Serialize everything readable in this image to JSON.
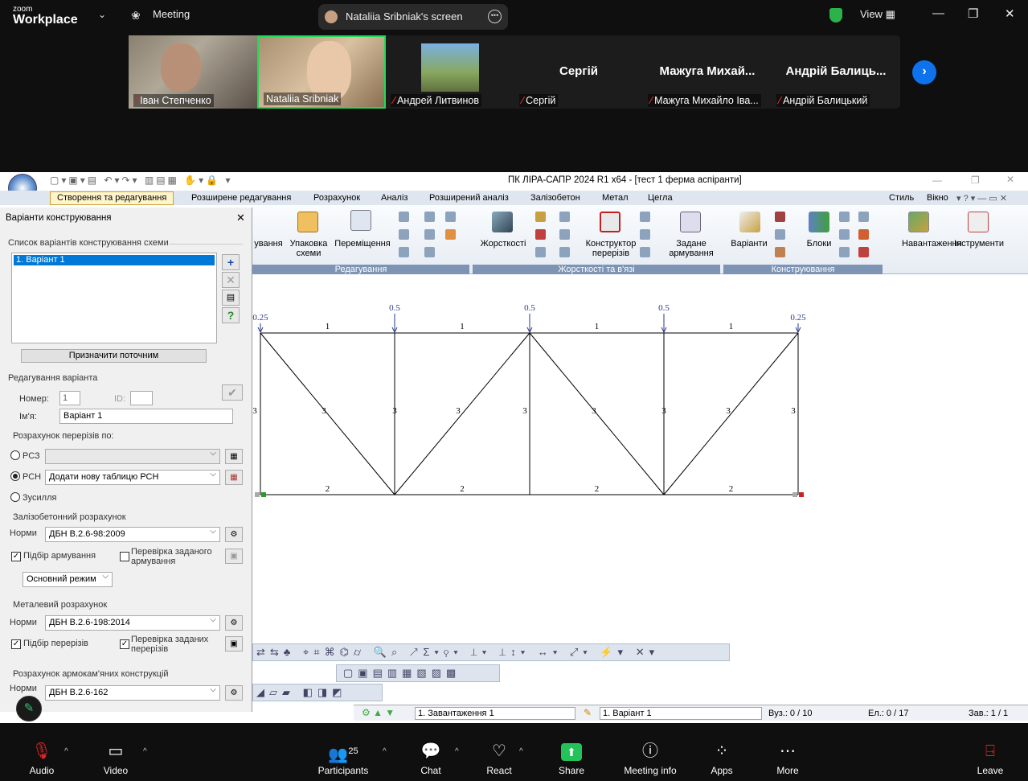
{
  "zoom": {
    "logo_top": "zoom",
    "logo_bottom": "Workplace",
    "meeting": "Meeting",
    "screen_share": "Nataliia Sribniak's screen",
    "view": "View",
    "participants": [
      {
        "name": "Іван Степченко",
        "muted": true,
        "video": true
      },
      {
        "name": "Nataliia Sribniak",
        "muted": false,
        "video": true
      },
      {
        "name": "Андрей Литвинов",
        "muted": true,
        "video": true
      },
      {
        "name": "Сергій",
        "muted": true,
        "big": "Сергій"
      },
      {
        "name": "Мажуга Михайло Іва...",
        "muted": true,
        "big": "Мажуга  Михай..."
      },
      {
        "name": "Андрій Балицький",
        "muted": true,
        "big": "Андрій  Балиць..."
      }
    ],
    "toolbar": {
      "audio": "Audio",
      "video": "Video",
      "participants": "Participants",
      "participants_count": "25",
      "chat": "Chat",
      "react": "React",
      "share": "Share",
      "meeting_info": "Meeting info",
      "apps": "Apps",
      "more": "More",
      "leave": "Leave"
    }
  },
  "lira": {
    "title": "ПК ЛІРА-САПР  2024 R1 x64 - [тест 1 ферма аспіранти]",
    "tabs": [
      "Створення та редагування",
      "Розширене редагування",
      "Розрахунок",
      "Аналіз",
      "Розширений аналіз",
      "Залізобетон",
      "Метал",
      "Цегла"
    ],
    "right_menu": [
      "Стиль",
      "Вікно"
    ],
    "ribbon": {
      "buttons": [
        "ування",
        "Упаковка схеми",
        "Переміщення",
        "Жорсткості",
        "Конструктор перерізів",
        "Задане армування",
        "Варіанти",
        "Блоки",
        "Навантаження",
        "Інструменти"
      ],
      "groups": [
        "Редагування",
        "Жорсткості та в'язі",
        "Конструювання"
      ]
    },
    "dialog": {
      "title": "Варіанти конструювання",
      "list_label": "Список варіантів конструювання схеми",
      "list_items": [
        "1. Варіант 1"
      ],
      "assign_btn": "Призначити поточним",
      "edit_label": "Редагування варіанта",
      "number_label": "Номер:",
      "number_value": "1",
      "id_label": "ID:",
      "name_label": "Ім'я:",
      "name_value": "Варіант 1",
      "calc_label": "Розрахунок перерізів по:",
      "opt_rsz": "РСЗ",
      "opt_rsn": "РСН",
      "opt_forces": "Зусилля",
      "rsn_combo": "Додати нову таблицю РСН",
      "rc_label": "Залізобетонний розрахунок",
      "norms": "Норми",
      "rc_norm": "ДБН В.2.6-98:2009",
      "rc_check1": "Підбір армування",
      "rc_check2": "Перевірка заданого армування",
      "mode": "Основний режим",
      "steel_label": "Металевий розрахунок",
      "steel_norm": "ДБН В.2.6-198:2014",
      "steel_check1": "Підбір перерізів",
      "steel_check2": "Перевірка заданих перерізів",
      "masonry_label": "Розрахунок армокам'яних конструкцій",
      "masonry_norm": "ДБН В.2.6-162"
    },
    "truss": {
      "loads": [
        "0.25",
        "0.5",
        "0.5",
        "0.5",
        "0.25"
      ],
      "top_chord": [
        "1",
        "1",
        "1",
        "1"
      ],
      "bottom_chord": [
        "2",
        "2",
        "2",
        "2"
      ],
      "diagonals": [
        "3",
        "3",
        "3",
        "3",
        "3",
        "3",
        "3",
        "3",
        "3"
      ]
    },
    "status": {
      "load_case": "1. Завантаження 1",
      "variant": "1. Варіант 1",
      "nodes": "Вуз.: 0 / 10",
      "elements": "Ел.: 0 / 17",
      "loads": "Зав.: 1 / 1"
    }
  }
}
